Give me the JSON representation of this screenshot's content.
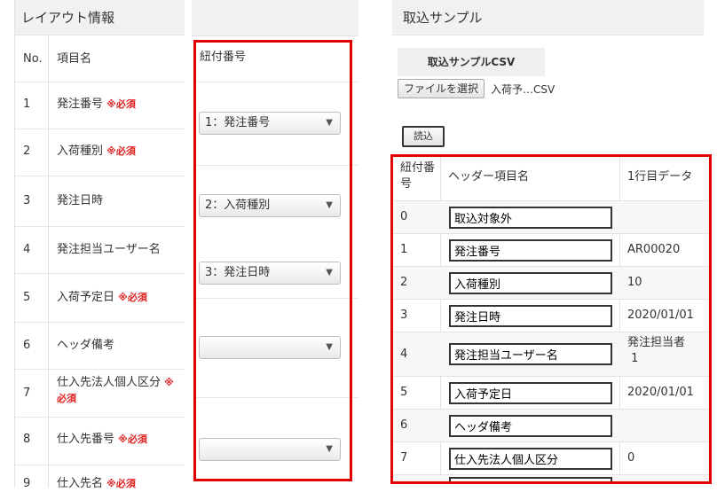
{
  "layout": {
    "title": "レイアウト情報",
    "headers": {
      "no": "No.",
      "name": "項目名"
    },
    "rows": [
      {
        "no": "1",
        "name": "発注番号",
        "req": "※必須"
      },
      {
        "no": "2",
        "name": "入荷種別",
        "req": "※必須"
      },
      {
        "no": "3",
        "name": "発注日時",
        "req": ""
      },
      {
        "no": "4",
        "name": "発注担当ユーザー名",
        "req": ""
      },
      {
        "no": "5",
        "name": "入荷予定日",
        "req": "※必須"
      },
      {
        "no": "6",
        "name": "ヘッダ備考",
        "req": ""
      },
      {
        "no": "7",
        "name": "仕入先法人個人区分",
        "req": "※",
        "req2": "必須"
      },
      {
        "no": "8",
        "name": "仕入先番号",
        "req": "※必須"
      },
      {
        "no": "9",
        "name": "仕入先名",
        "req": "※必須"
      }
    ]
  },
  "mapping": {
    "header": "紐付番号",
    "selects": [
      "1：発注番号",
      "2：入荷種別",
      "3：発注日時",
      "",
      ""
    ]
  },
  "sample": {
    "title": "取込サンプル",
    "tab_label": "取込サンプルCSV",
    "file_button": "ファイルを選択",
    "file_name": "入荷予…CSV",
    "read_button": "読込",
    "table_headers": {
      "num": "紐付番号",
      "header": "ヘッダー項目名",
      "first": "1行目データ"
    },
    "rows": [
      {
        "num": "0",
        "header": "取込対象外",
        "value": ""
      },
      {
        "num": "1",
        "header": "発注番号",
        "value": "AR00020"
      },
      {
        "num": "2",
        "header": "入荷種別",
        "value": "10"
      },
      {
        "num": "3",
        "header": "発注日時",
        "value": "2020/01/01"
      },
      {
        "num": "4",
        "header": "発注担当ユーザー名",
        "value": "発注担当者",
        "value2": "1"
      },
      {
        "num": "5",
        "header": "入荷予定日",
        "value": "2020/01/01"
      },
      {
        "num": "6",
        "header": "ヘッダ備考",
        "value": ""
      },
      {
        "num": "7",
        "header": "仕入先法人個人区分",
        "value": "0"
      }
    ]
  },
  "colors": {
    "highlight": "#e00000",
    "required": "#e02020"
  }
}
